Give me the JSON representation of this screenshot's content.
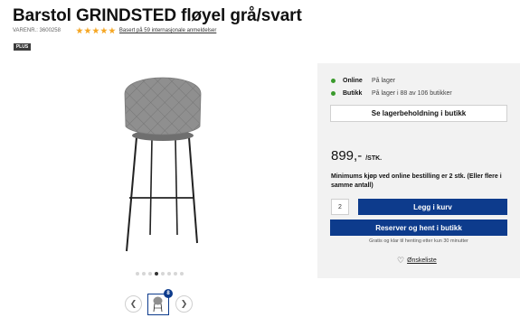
{
  "product": {
    "title": "Barstol GRINDSTED fløyel grå/svart",
    "sku": "VARENR.: 3600258",
    "rating_stars": 5,
    "reviews_link": "Basert på 59 internasjonale anmeldelser",
    "badge": "PLUS"
  },
  "gallery": {
    "image_count": 8,
    "active_dot_index": 3,
    "dots": 8,
    "thumb_badge": "8",
    "prev_icon": "chevron-left-icon",
    "next_icon": "chevron-right-icon"
  },
  "availability": {
    "online_label": "Online",
    "online_value": "På lager",
    "store_label": "Butikk",
    "store_value": "På lager i 88 av 106 butikker",
    "stock_button": "Se lagerbeholdning i butikk"
  },
  "pricing": {
    "price": "899,-",
    "unit": "/STK.",
    "minimum_note": "Minimums kjøp ved online bestilling er 2 stk. (Eller flere i samme antall)"
  },
  "purchase": {
    "quantity": "2",
    "add_to_cart": "Legg i kurv",
    "reserve": "Reserver og hent i butikk",
    "pickup_note": "Gratis og klar til henting etter kun 30 minutter",
    "wishlist": "Ønskeliste"
  },
  "colors": {
    "brand_blue": "#0d3b8c",
    "in_stock_green": "#3a9a2c",
    "star_gold": "#f5a623",
    "panel_bg": "#f2f2f2"
  }
}
